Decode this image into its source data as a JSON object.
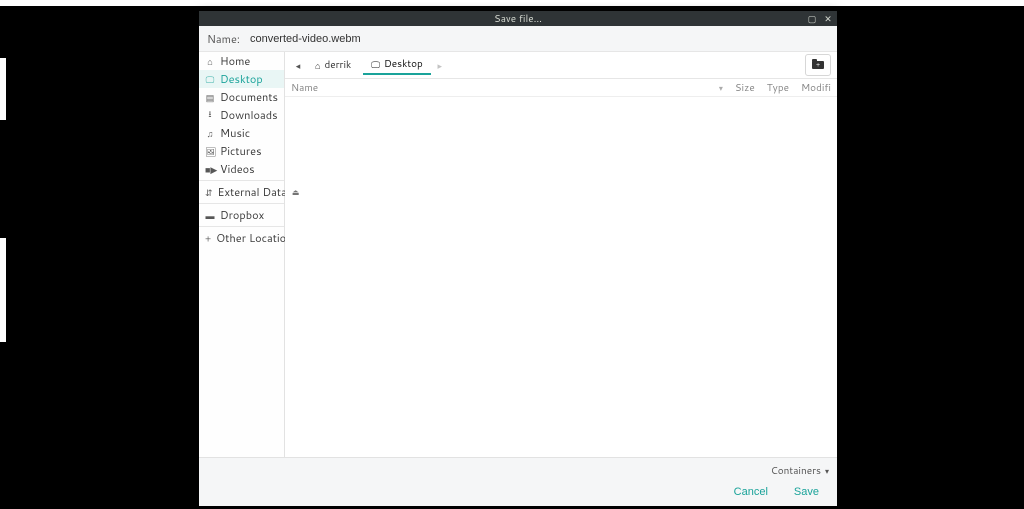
{
  "window": {
    "title": "Save file..."
  },
  "name_row": {
    "label": "Name:",
    "value": "converted-video.webm"
  },
  "sidebar": {
    "groups": [
      {
        "items": [
          {
            "icon": "home-icon",
            "glyph": "⌂",
            "label": "Home",
            "selected": false
          },
          {
            "icon": "desktop-icon",
            "glyph": "🖵",
            "label": "Desktop",
            "selected": true
          },
          {
            "icon": "documents-icon",
            "glyph": "▤",
            "label": "Documents",
            "selected": false
          },
          {
            "icon": "downloads-icon",
            "glyph": "⭳",
            "label": "Downloads",
            "selected": false
          },
          {
            "icon": "music-icon",
            "glyph": "♫",
            "label": "Music",
            "selected": false
          },
          {
            "icon": "pictures-icon",
            "glyph": "🖼",
            "label": "Pictures",
            "selected": false
          },
          {
            "icon": "videos-icon",
            "glyph": "■▶",
            "label": "Videos",
            "selected": false
          }
        ]
      },
      {
        "items": [
          {
            "icon": "drive-icon",
            "glyph": "⇵",
            "label": "External Data",
            "selected": false,
            "ejectable": true
          }
        ]
      },
      {
        "items": [
          {
            "icon": "folder-icon",
            "glyph": "▬",
            "label": "Dropbox",
            "selected": false
          }
        ]
      },
      {
        "items": [
          {
            "icon": "plus-icon",
            "glyph": "+",
            "label": "Other Locations",
            "selected": false
          }
        ]
      }
    ]
  },
  "pathbar": {
    "back_enabled": true,
    "forward_enabled": false,
    "crumbs": [
      {
        "icon": "home-icon",
        "glyph": "⌂",
        "label": "derrik",
        "active": false
      },
      {
        "icon": "desktop-icon",
        "glyph": "🖵",
        "label": "Desktop",
        "active": true
      }
    ]
  },
  "columns": {
    "name": "Name",
    "size": "Size",
    "type": "Type",
    "modified": "Modifi"
  },
  "footer": {
    "filter_label": "Containers",
    "cancel": "Cancel",
    "save": "Save"
  }
}
